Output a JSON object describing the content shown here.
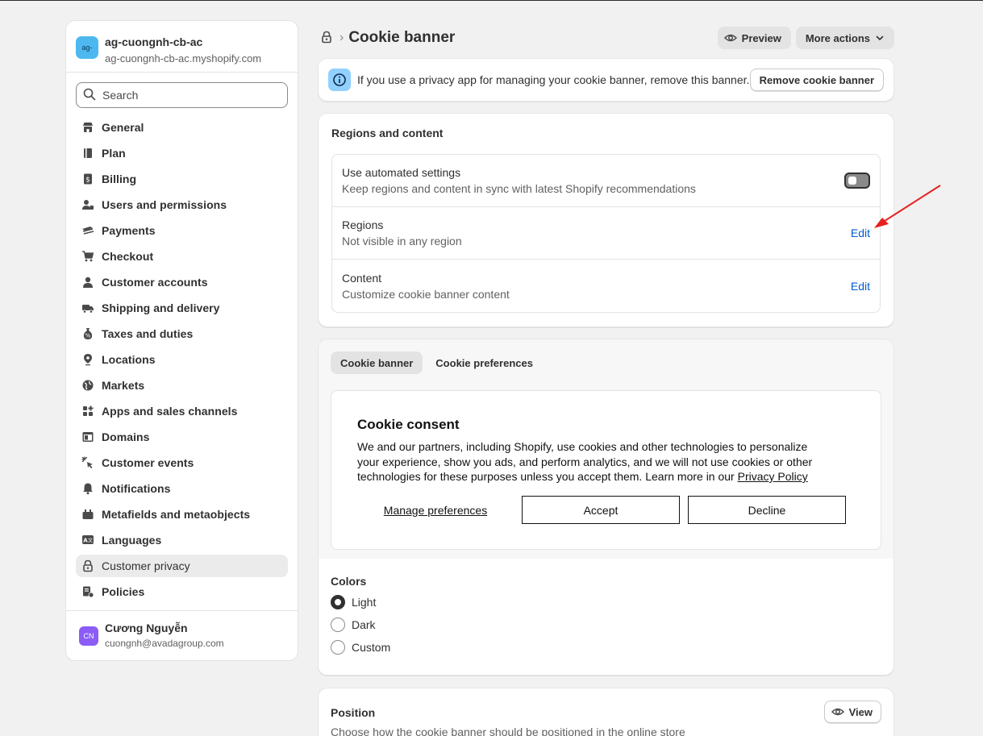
{
  "store": {
    "avatar": "ag-",
    "name": "ag-cuongnh-cb-ac",
    "url": "ag-cuongnh-cb-ac.myshopify.com"
  },
  "search": {
    "placeholder": "Search"
  },
  "nav": [
    {
      "label": "General",
      "icon": "store-icon"
    },
    {
      "label": "Plan",
      "icon": "plan-icon"
    },
    {
      "label": "Billing",
      "icon": "billing-icon"
    },
    {
      "label": "Users and permissions",
      "icon": "users-icon"
    },
    {
      "label": "Payments",
      "icon": "payments-icon"
    },
    {
      "label": "Checkout",
      "icon": "cart-icon"
    },
    {
      "label": "Customer accounts",
      "icon": "person-icon"
    },
    {
      "label": "Shipping and delivery",
      "icon": "truck-icon"
    },
    {
      "label": "Taxes and duties",
      "icon": "tax-icon"
    },
    {
      "label": "Locations",
      "icon": "location-icon"
    },
    {
      "label": "Markets",
      "icon": "globe-icon"
    },
    {
      "label": "Apps and sales channels",
      "icon": "apps-icon"
    },
    {
      "label": "Domains",
      "icon": "domains-icon"
    },
    {
      "label": "Customer events",
      "icon": "events-icon"
    },
    {
      "label": "Notifications",
      "icon": "bell-icon"
    },
    {
      "label": "Metafields and metaobjects",
      "icon": "metafields-icon"
    },
    {
      "label": "Languages",
      "icon": "languages-icon"
    },
    {
      "label": "Customer privacy",
      "icon": "lock-icon",
      "active": true
    },
    {
      "label": "Policies",
      "icon": "policies-icon"
    }
  ],
  "user": {
    "initials": "CN",
    "name": "Cương Nguyễn",
    "email": "cuongnh@avadagroup.com"
  },
  "header": {
    "title": "Cookie banner",
    "preview_label": "Preview",
    "more_actions_label": "More actions"
  },
  "banner": {
    "text": "If you use a privacy app for managing your cookie banner, remove this banner.",
    "button_label": "Remove cookie banner"
  },
  "regions_card": {
    "title": "Regions and content",
    "rows": [
      {
        "title": "Use automated settings",
        "subtitle": "Keep regions and content in sync with latest Shopify recommendations",
        "toggle_on": false
      },
      {
        "title": "Regions",
        "subtitle": "Not visible in any region",
        "action": "Edit"
      },
      {
        "title": "Content",
        "subtitle": "Customize cookie banner content",
        "action": "Edit"
      }
    ]
  },
  "preview": {
    "tabs": [
      "Cookie banner",
      "Cookie preferences"
    ],
    "active_tab": "Cookie banner",
    "consent": {
      "title": "Cookie consent",
      "body": "We and our partners, including Shopify, use cookies and other technologies to personalize your experience, show you ads, and perform analytics, and we will not use cookies or other technologies for these purposes unless you accept them. Learn more in our ",
      "policy_link": "Privacy Policy",
      "manage_label": "Manage preferences",
      "accept_label": "Accept",
      "decline_label": "Decline"
    }
  },
  "colors": {
    "title": "Colors",
    "options": [
      "Light",
      "Dark",
      "Custom"
    ],
    "selected": "Light"
  },
  "position": {
    "title": "Position",
    "subtitle": "Choose how the cookie banner should be positioned in the online store",
    "view_label": "View"
  },
  "accent": {
    "link": "#005bd3",
    "store_avatar_bg": "#4db8f0",
    "user_avatar_bg": "#8b5cf6",
    "info_badge_bg": "#91d0ff",
    "annotation_arrow": "#e8201f"
  }
}
